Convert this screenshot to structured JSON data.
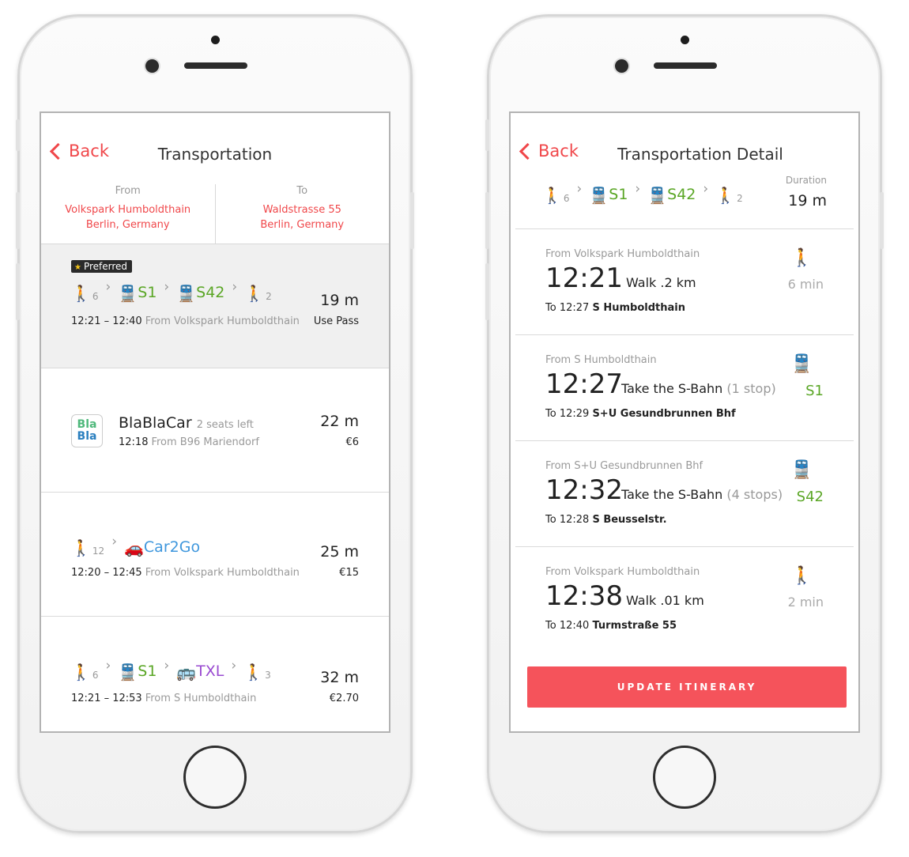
{
  "left": {
    "back_label": "Back",
    "title": "Transportation",
    "from_label": "From",
    "from_line1": "Volkspark Humboldthain",
    "from_line2": "Berlin, Germany",
    "to_label": "To",
    "to_line1": "Waldstrasse 55",
    "to_line2": "Berlin, Germany",
    "options": [
      {
        "badge": "Preferred",
        "walk1_sub": "6",
        "line1": "S1",
        "line2": "S42",
        "walk2_sub": "2",
        "time": "12:21 – 12:40",
        "from": "From Volkspark Humboldthain",
        "duration": "19 m",
        "price": "Use Pass"
      },
      {
        "name": "BlaBlaCar",
        "seats": "2 seats left",
        "time": "12:18",
        "from": "From B96 Mariendorf",
        "duration": "22 m",
        "price": "€6",
        "logo_top": "Bla",
        "logo_bottom": "Bla"
      },
      {
        "walk1_sub": "12",
        "line1": "Car2Go",
        "time": "12:20 – 12:45",
        "from": "From Volkspark Humboldthain",
        "duration": "25 m",
        "price": "€15"
      },
      {
        "walk1_sub": "6",
        "line1": "S1",
        "line2": "TXL",
        "walk2_sub": "3",
        "time": "12:21 – 12:53",
        "from": "From S Humboldthain",
        "duration": "32 m",
        "price": "€2.70"
      }
    ]
  },
  "right": {
    "back_label": "Back",
    "title": "Transportation Detail",
    "summary": {
      "walk1_sub": "6",
      "line1": "S1",
      "line2": "S42",
      "walk2_sub": "2",
      "duration_label": "Duration",
      "duration_value": "19 m"
    },
    "steps": [
      {
        "from": "From Volkspark Humboldthain",
        "time": "12:21",
        "action": "Walk .2 km",
        "extra": "",
        "to_time": "To 12:27",
        "to_place": "S Humboldthain",
        "side": "6 min",
        "icon": "walk-icon"
      },
      {
        "from": "From S Humboldthain",
        "time": "12:27",
        "action": "Take the S-Bahn",
        "extra": "(1 stop)",
        "to_time": "To 12:29",
        "to_place": "S+U Gesundbrunnen Bhf",
        "side": "S1",
        "icon": "train-icon"
      },
      {
        "from": "From S+U Gesundbrunnen Bhf",
        "time": "12:32",
        "action": "Take the S-Bahn",
        "extra": "(4 stops)",
        "to_time": "To 12:28",
        "to_place": "S Beusselstr.",
        "side": "S42",
        "icon": "train-icon"
      },
      {
        "from": "From Volkspark Humboldthain",
        "time": "12:38",
        "action": "Walk .01 km",
        "extra": "",
        "to_time": "To 12:40",
        "to_place": "Turmstraße 55",
        "side": "2 min",
        "icon": "walk-icon"
      }
    ],
    "update_button": "UPDATE ITINERARY"
  },
  "colors": {
    "accent_red": "#f0474a",
    "button_red": "#f5535b",
    "line_green": "#5aa625",
    "line_purple": "#9a4bd1",
    "line_blue": "#3f97dd"
  }
}
